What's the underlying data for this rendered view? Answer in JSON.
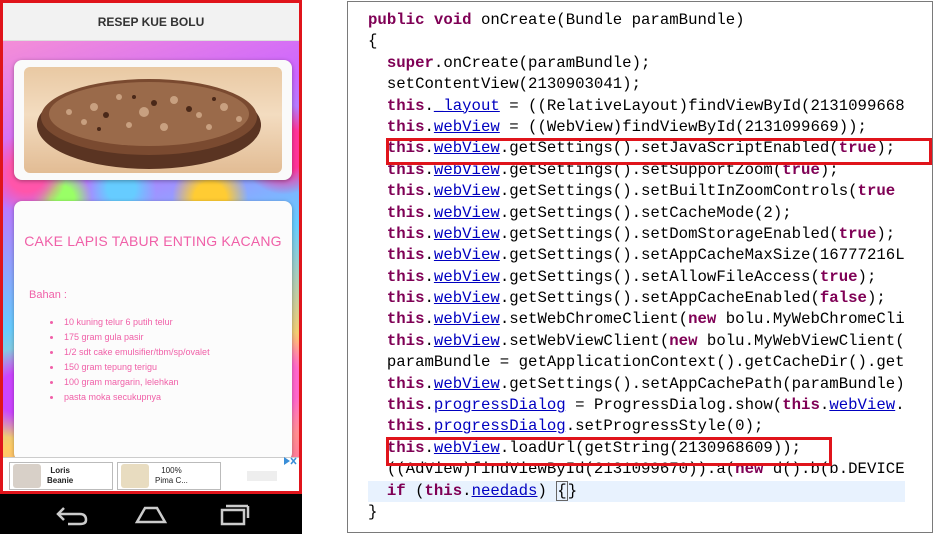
{
  "phone": {
    "app_title": "RESEP KUE BOLU",
    "recipe": {
      "title": "CAKE LAPIS TABUR ENTING KACANG",
      "section_label": "Bahan :",
      "ingredients": [
        "10 kuning telur 6 putih telur",
        "175 gram gula pasir",
        "1/2 sdt cake emulsifier/tbm/sp/ovalet",
        "150 gram tepung terigu",
        "100 gram margarin, lelehkan",
        "pasta moka secukupnya"
      ]
    },
    "ads": [
      {
        "label_line1": "Loris",
        "label_line2": "Beanie"
      },
      {
        "label_line1": "100%",
        "label_line2": "Pima C..."
      }
    ],
    "navbar": [
      "back-icon",
      "home-icon",
      "recents-icon"
    ]
  },
  "code": {
    "lines": [
      "public void onCreate(Bundle paramBundle)",
      "{",
      "  super.onCreate(paramBundle);",
      "  setContentView(2130903041);",
      "  this._layout = ((RelativeLayout)findViewById(2131099668",
      "  this.webView = ((WebView)findViewById(2131099669));",
      "  this.webView.getSettings().setJavaScriptEnabled(true);",
      "  this.webView.getSettings().setSupportZoom(true);",
      "  this.webView.getSettings().setBuiltInZoomControls(true",
      "  this.webView.getSettings().setCacheMode(2);",
      "  this.webView.getSettings().setDomStorageEnabled(true);",
      "  this.webView.getSettings().setAppCacheMaxSize(16777216L",
      "  this.webView.getSettings().setAllowFileAccess(true);",
      "  this.webView.getSettings().setAppCacheEnabled(false);",
      "  this.webView.setWebChromeClient(new bolu.MyWebChromeCli",
      "  this.webView.setWebViewClient(new bolu.MyWebViewClient(",
      "  paramBundle = getApplicationContext().getCacheDir().get",
      "  this.webView.getSettings().setAppCachePath(paramBundle)",
      "  this.progressDialog = ProgressDialog.show(this.webView.",
      "  this.progressDialog.setProgressStyle(0);",
      "  this.webView.loadUrl(getString(2130968609));",
      "  ((AdView)findViewById(2131099670)).a(new d().b(b.DEVICE",
      "  if (this.needads) {}",
      "}"
    ]
  },
  "colors": {
    "highlight_box": "#e0141b",
    "recipe_pink": "#f060a8",
    "java_keyword": "#7f0055",
    "java_field": "#0000c0"
  }
}
